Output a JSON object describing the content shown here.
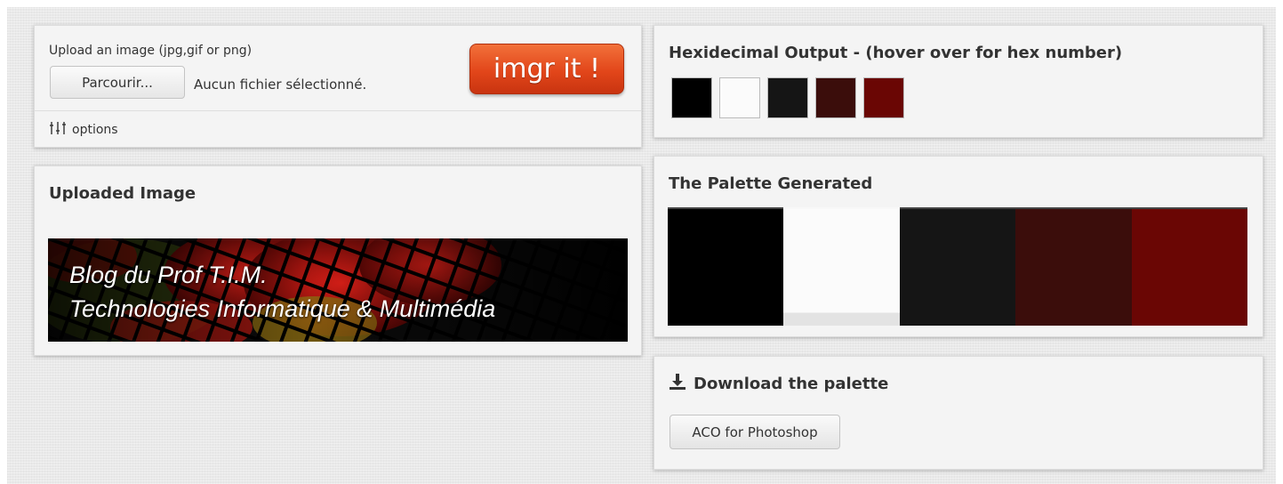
{
  "upload": {
    "label": "Upload an image (jpg,gif or png)",
    "browse_label": "Parcourir...",
    "no_file_label": "Aucun fichier sélectionné.",
    "submit_label": "imgr it !",
    "options_label": "options"
  },
  "uploaded": {
    "title": "Uploaded Image",
    "banner_line1": "Blog du Prof T.I.M.",
    "banner_line2": "Technologies Informatique & Multimédia"
  },
  "hex": {
    "title": "Hexidecimal Output - (hover over for hex number)",
    "colors": [
      "#000000",
      "#fbfbfb",
      "#151515",
      "#3b0d0b",
      "#6a0604"
    ]
  },
  "palette": {
    "title": "The Palette Generated",
    "colors": [
      "#000000",
      "#fbfbfb",
      "#151515",
      "#3b0d0b",
      "#6a0604"
    ],
    "levels": [
      1,
      0.89,
      1,
      1,
      1
    ]
  },
  "download": {
    "title": "Download the palette",
    "aco_label": "ACO for Photoshop"
  }
}
